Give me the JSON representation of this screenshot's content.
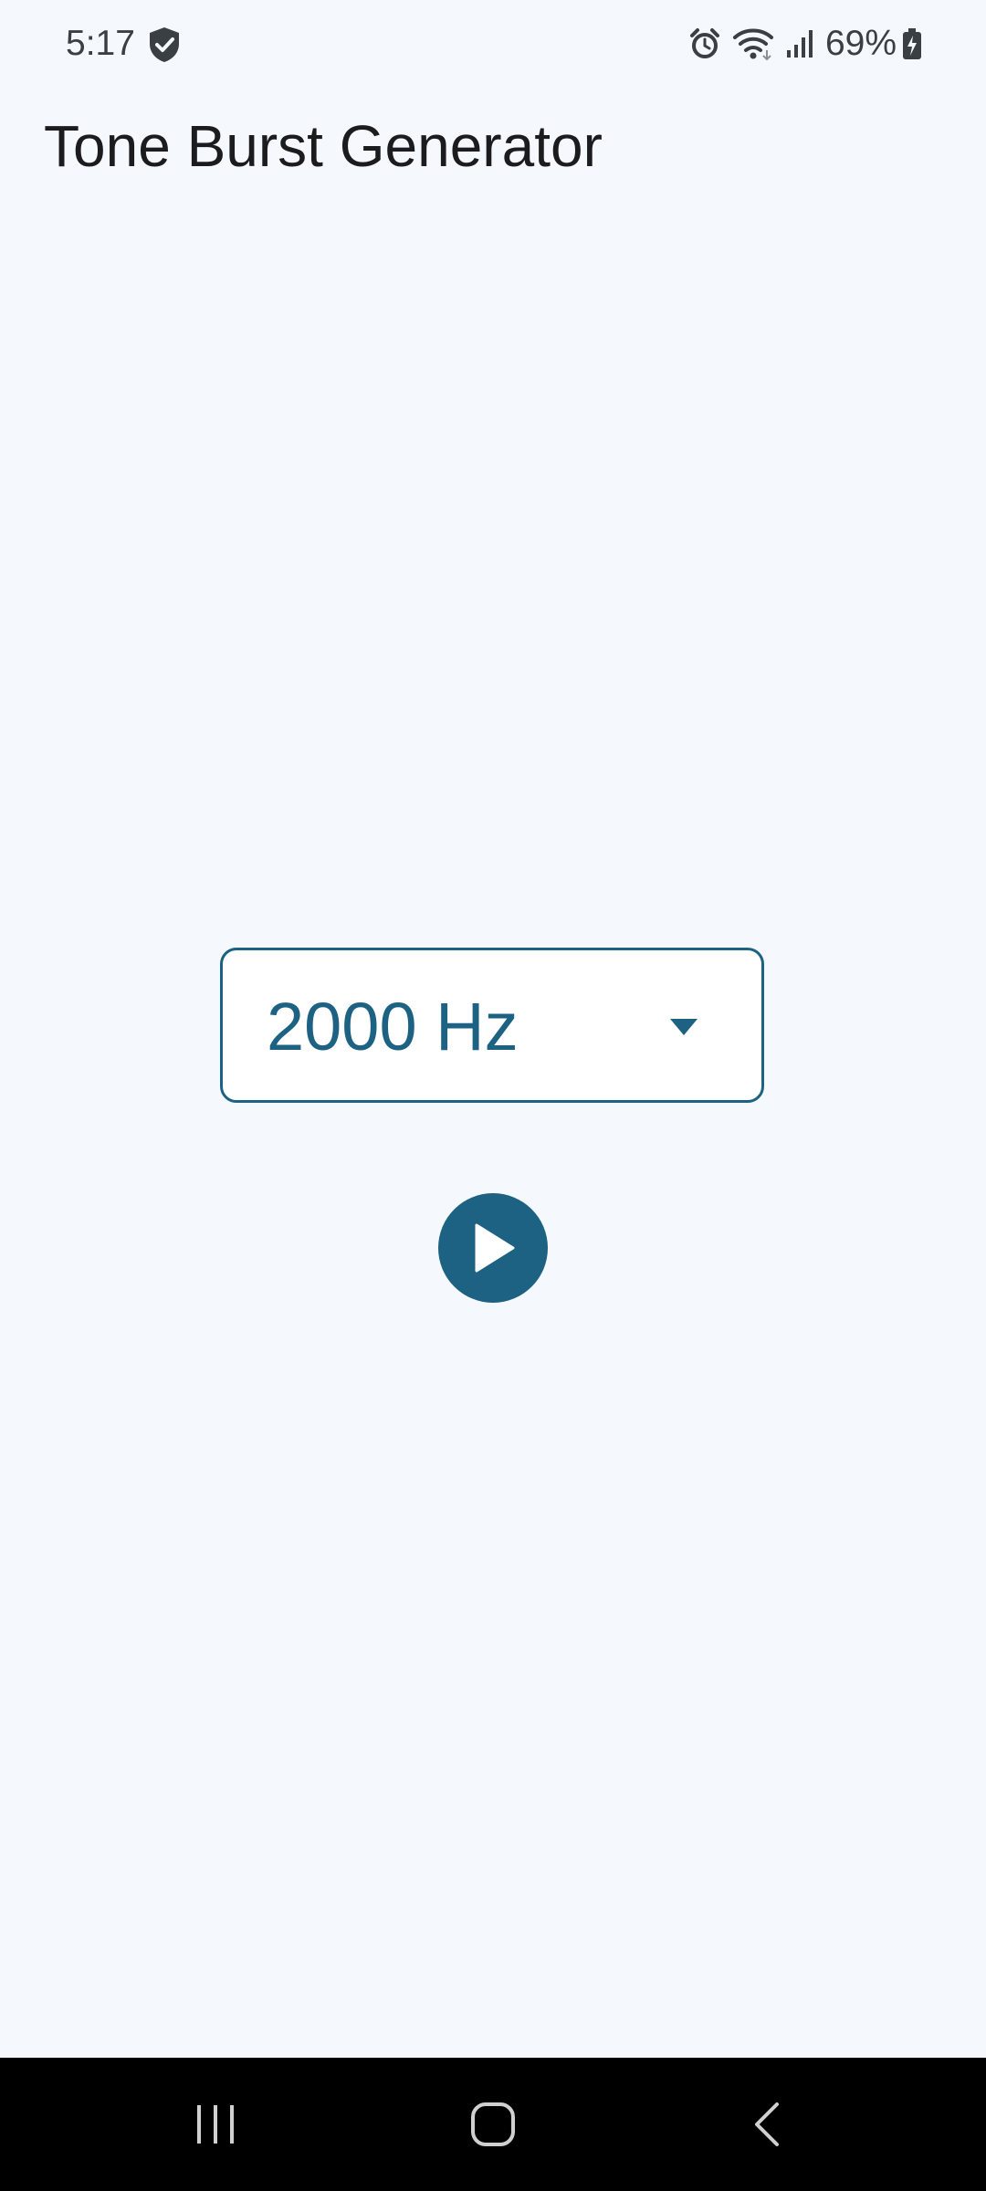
{
  "status_bar": {
    "time": "5:17",
    "battery_percent": "69%",
    "icons": [
      "shield-check-icon",
      "alarm-icon",
      "wifi-icon",
      "signal-icon",
      "battery-charging-icon"
    ]
  },
  "app": {
    "title": "Tone Burst Generator",
    "accent_color": "#1d6282",
    "background_color": "#f5f8fd"
  },
  "frequency_select": {
    "selected_value": "2000 Hz",
    "icon": "arrow-drop-down-icon"
  },
  "play_button": {
    "icon": "play-icon"
  },
  "navigation_bar": {
    "icons": [
      "recent-apps-icon",
      "home-icon",
      "back-icon"
    ]
  }
}
